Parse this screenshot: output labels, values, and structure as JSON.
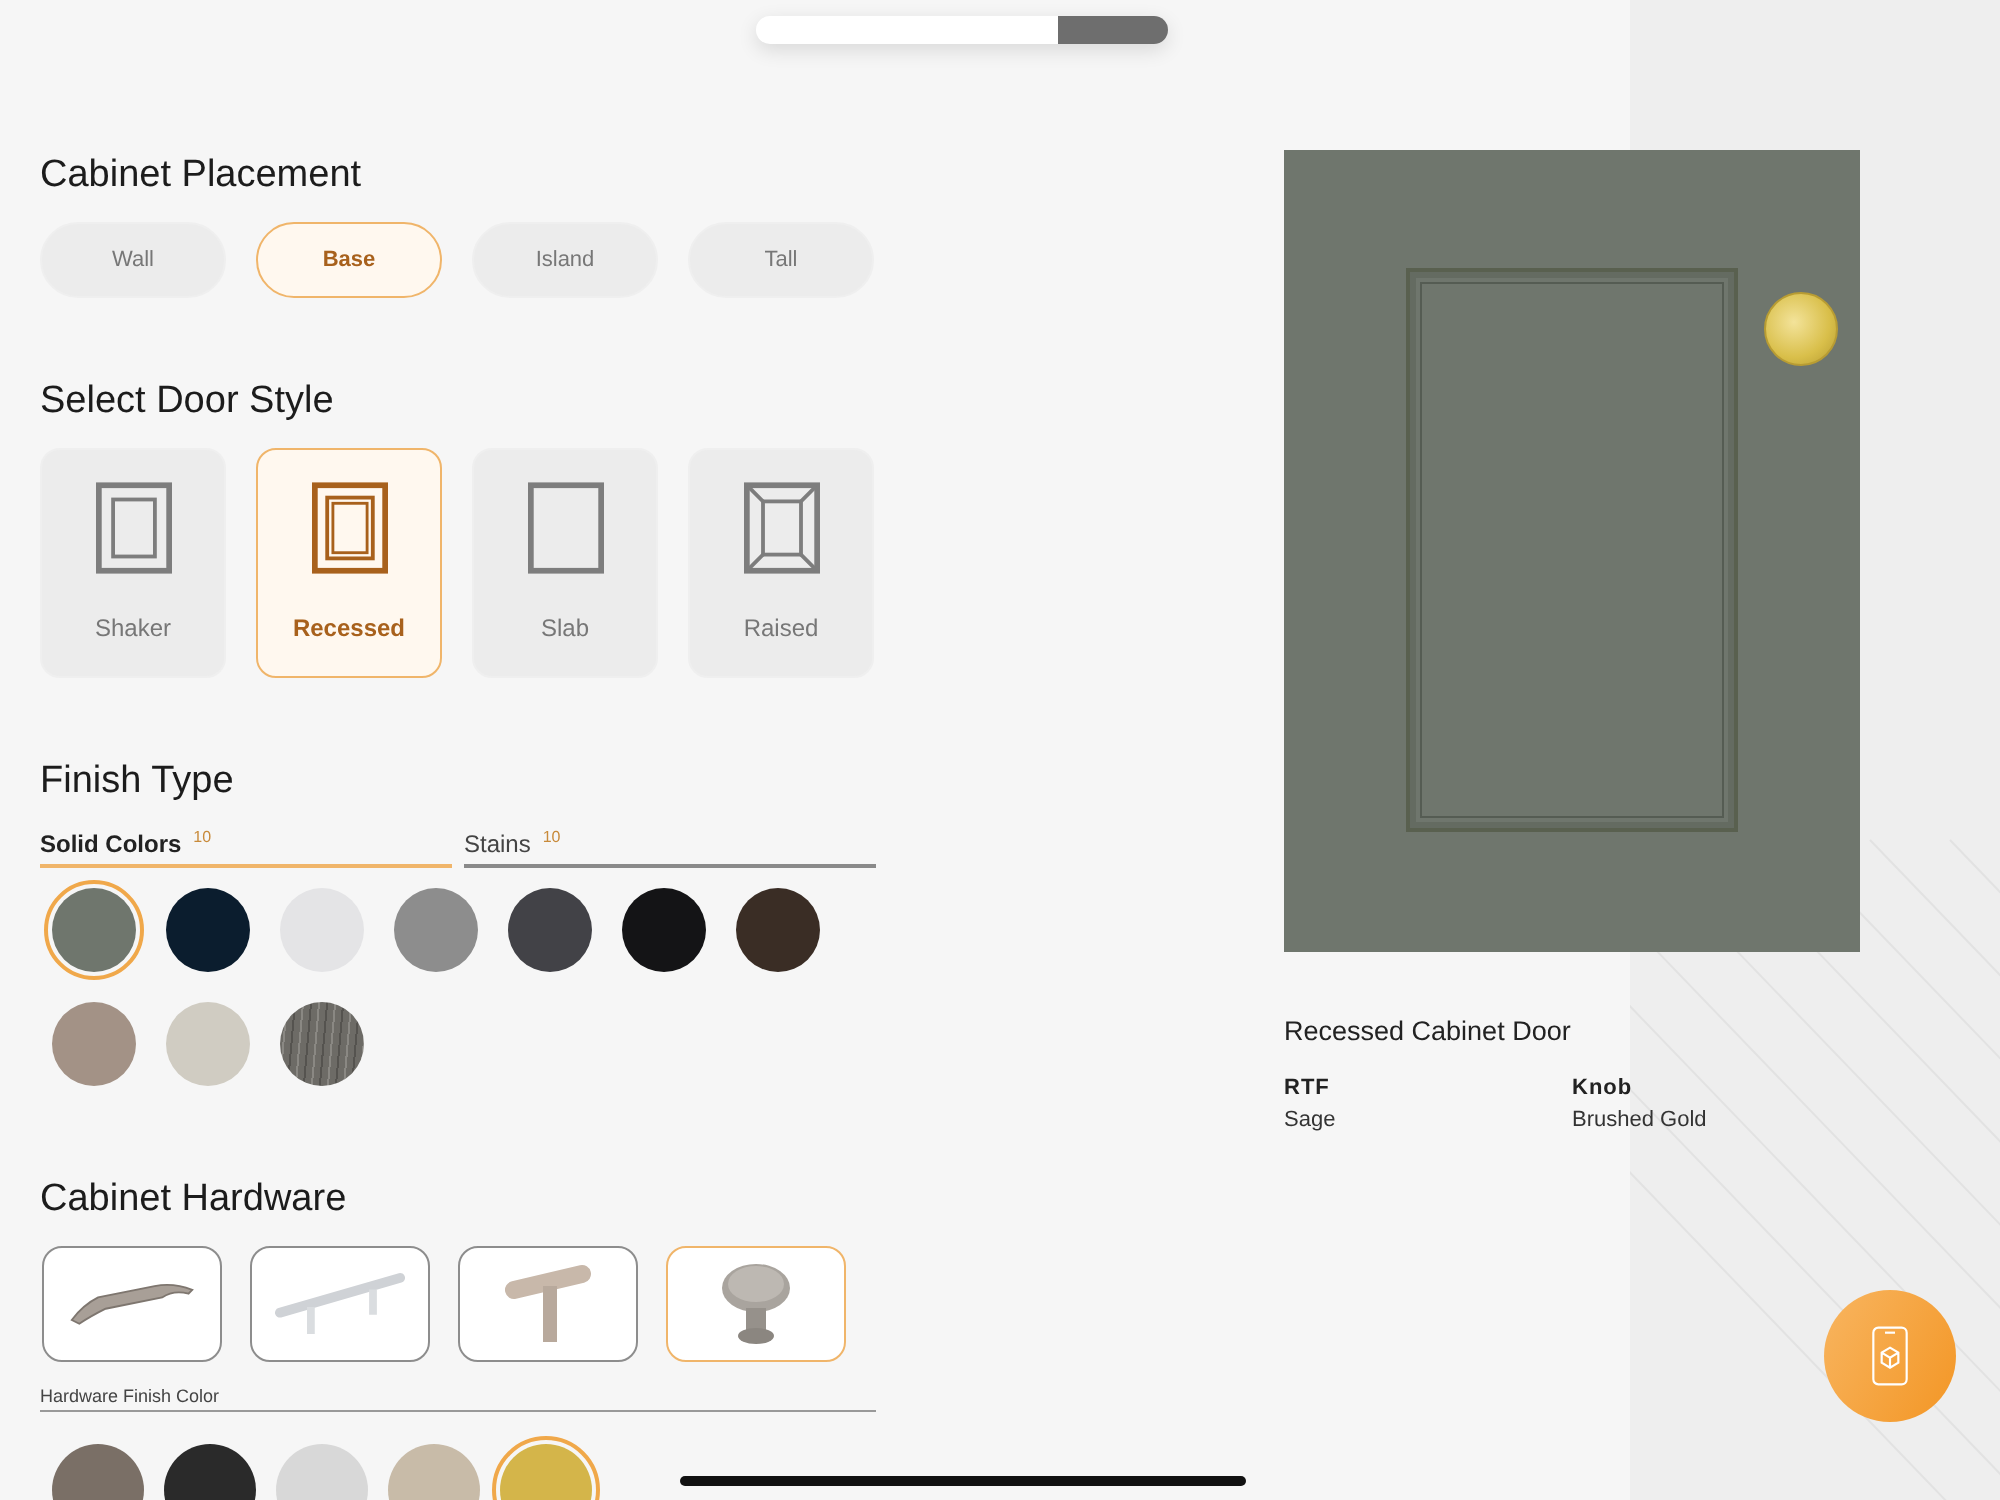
{
  "placement": {
    "title": "Cabinet Placement",
    "options": [
      {
        "label": "Wall",
        "selected": false
      },
      {
        "label": "Base",
        "selected": true
      },
      {
        "label": "Island",
        "selected": false
      },
      {
        "label": "Tall",
        "selected": false
      }
    ]
  },
  "door_style": {
    "title": "Select Door Style",
    "options": [
      {
        "kind": "shaker",
        "label": "Shaker",
        "selected": false
      },
      {
        "kind": "recessed",
        "label": "Recessed",
        "selected": true
      },
      {
        "kind": "slab",
        "label": "Slab",
        "selected": false
      },
      {
        "kind": "raised",
        "label": "Raised",
        "selected": false
      }
    ]
  },
  "finish": {
    "title": "Finish Type",
    "tabs": [
      {
        "label": "Solid Colors",
        "count": "10",
        "selected": true
      },
      {
        "label": "Stains",
        "count": "10",
        "selected": false
      }
    ],
    "swatches": [
      {
        "kind": "solid",
        "color": "#6f766d",
        "selected": true
      },
      {
        "kind": "solid",
        "color": "#0b1d2e",
        "selected": false
      },
      {
        "kind": "solid",
        "color": "#e4e4e6",
        "selected": false
      },
      {
        "kind": "solid",
        "color": "#8d8d8d",
        "selected": false
      },
      {
        "kind": "solid",
        "color": "#424247",
        "selected": false
      },
      {
        "kind": "solid",
        "color": "#141416",
        "selected": false
      },
      {
        "kind": "solid",
        "color": "#3a2d25",
        "selected": false
      },
      {
        "kind": "solid",
        "color": "#a39286",
        "selected": false
      },
      {
        "kind": "solid",
        "color": "#d0ccc2",
        "selected": false
      },
      {
        "kind": "texture",
        "color": "#6d6b66",
        "selected": false
      }
    ]
  },
  "hardware": {
    "title": "Cabinet Hardware",
    "options": [
      {
        "kind": "pull",
        "selected": false
      },
      {
        "kind": "bar",
        "selected": false
      },
      {
        "kind": "tbar",
        "selected": false
      },
      {
        "kind": "knob",
        "selected": true
      }
    ],
    "finish_label": "Hardware Finish Color",
    "finish_swatches": [
      {
        "color": "#7a6f66",
        "selected": false
      },
      {
        "color": "#2a2a2a",
        "selected": false
      },
      {
        "color": "#d8d8d8",
        "selected": false
      },
      {
        "color": "#c8bba8",
        "selected": false
      },
      {
        "color": "#d4b54a",
        "selected": true
      }
    ]
  },
  "preview": {
    "title": "Recessed Cabinet Door",
    "specs": [
      {
        "label": "RTF",
        "value": "Sage"
      },
      {
        "label": "Knob",
        "value": "Brushed Gold"
      }
    ]
  }
}
